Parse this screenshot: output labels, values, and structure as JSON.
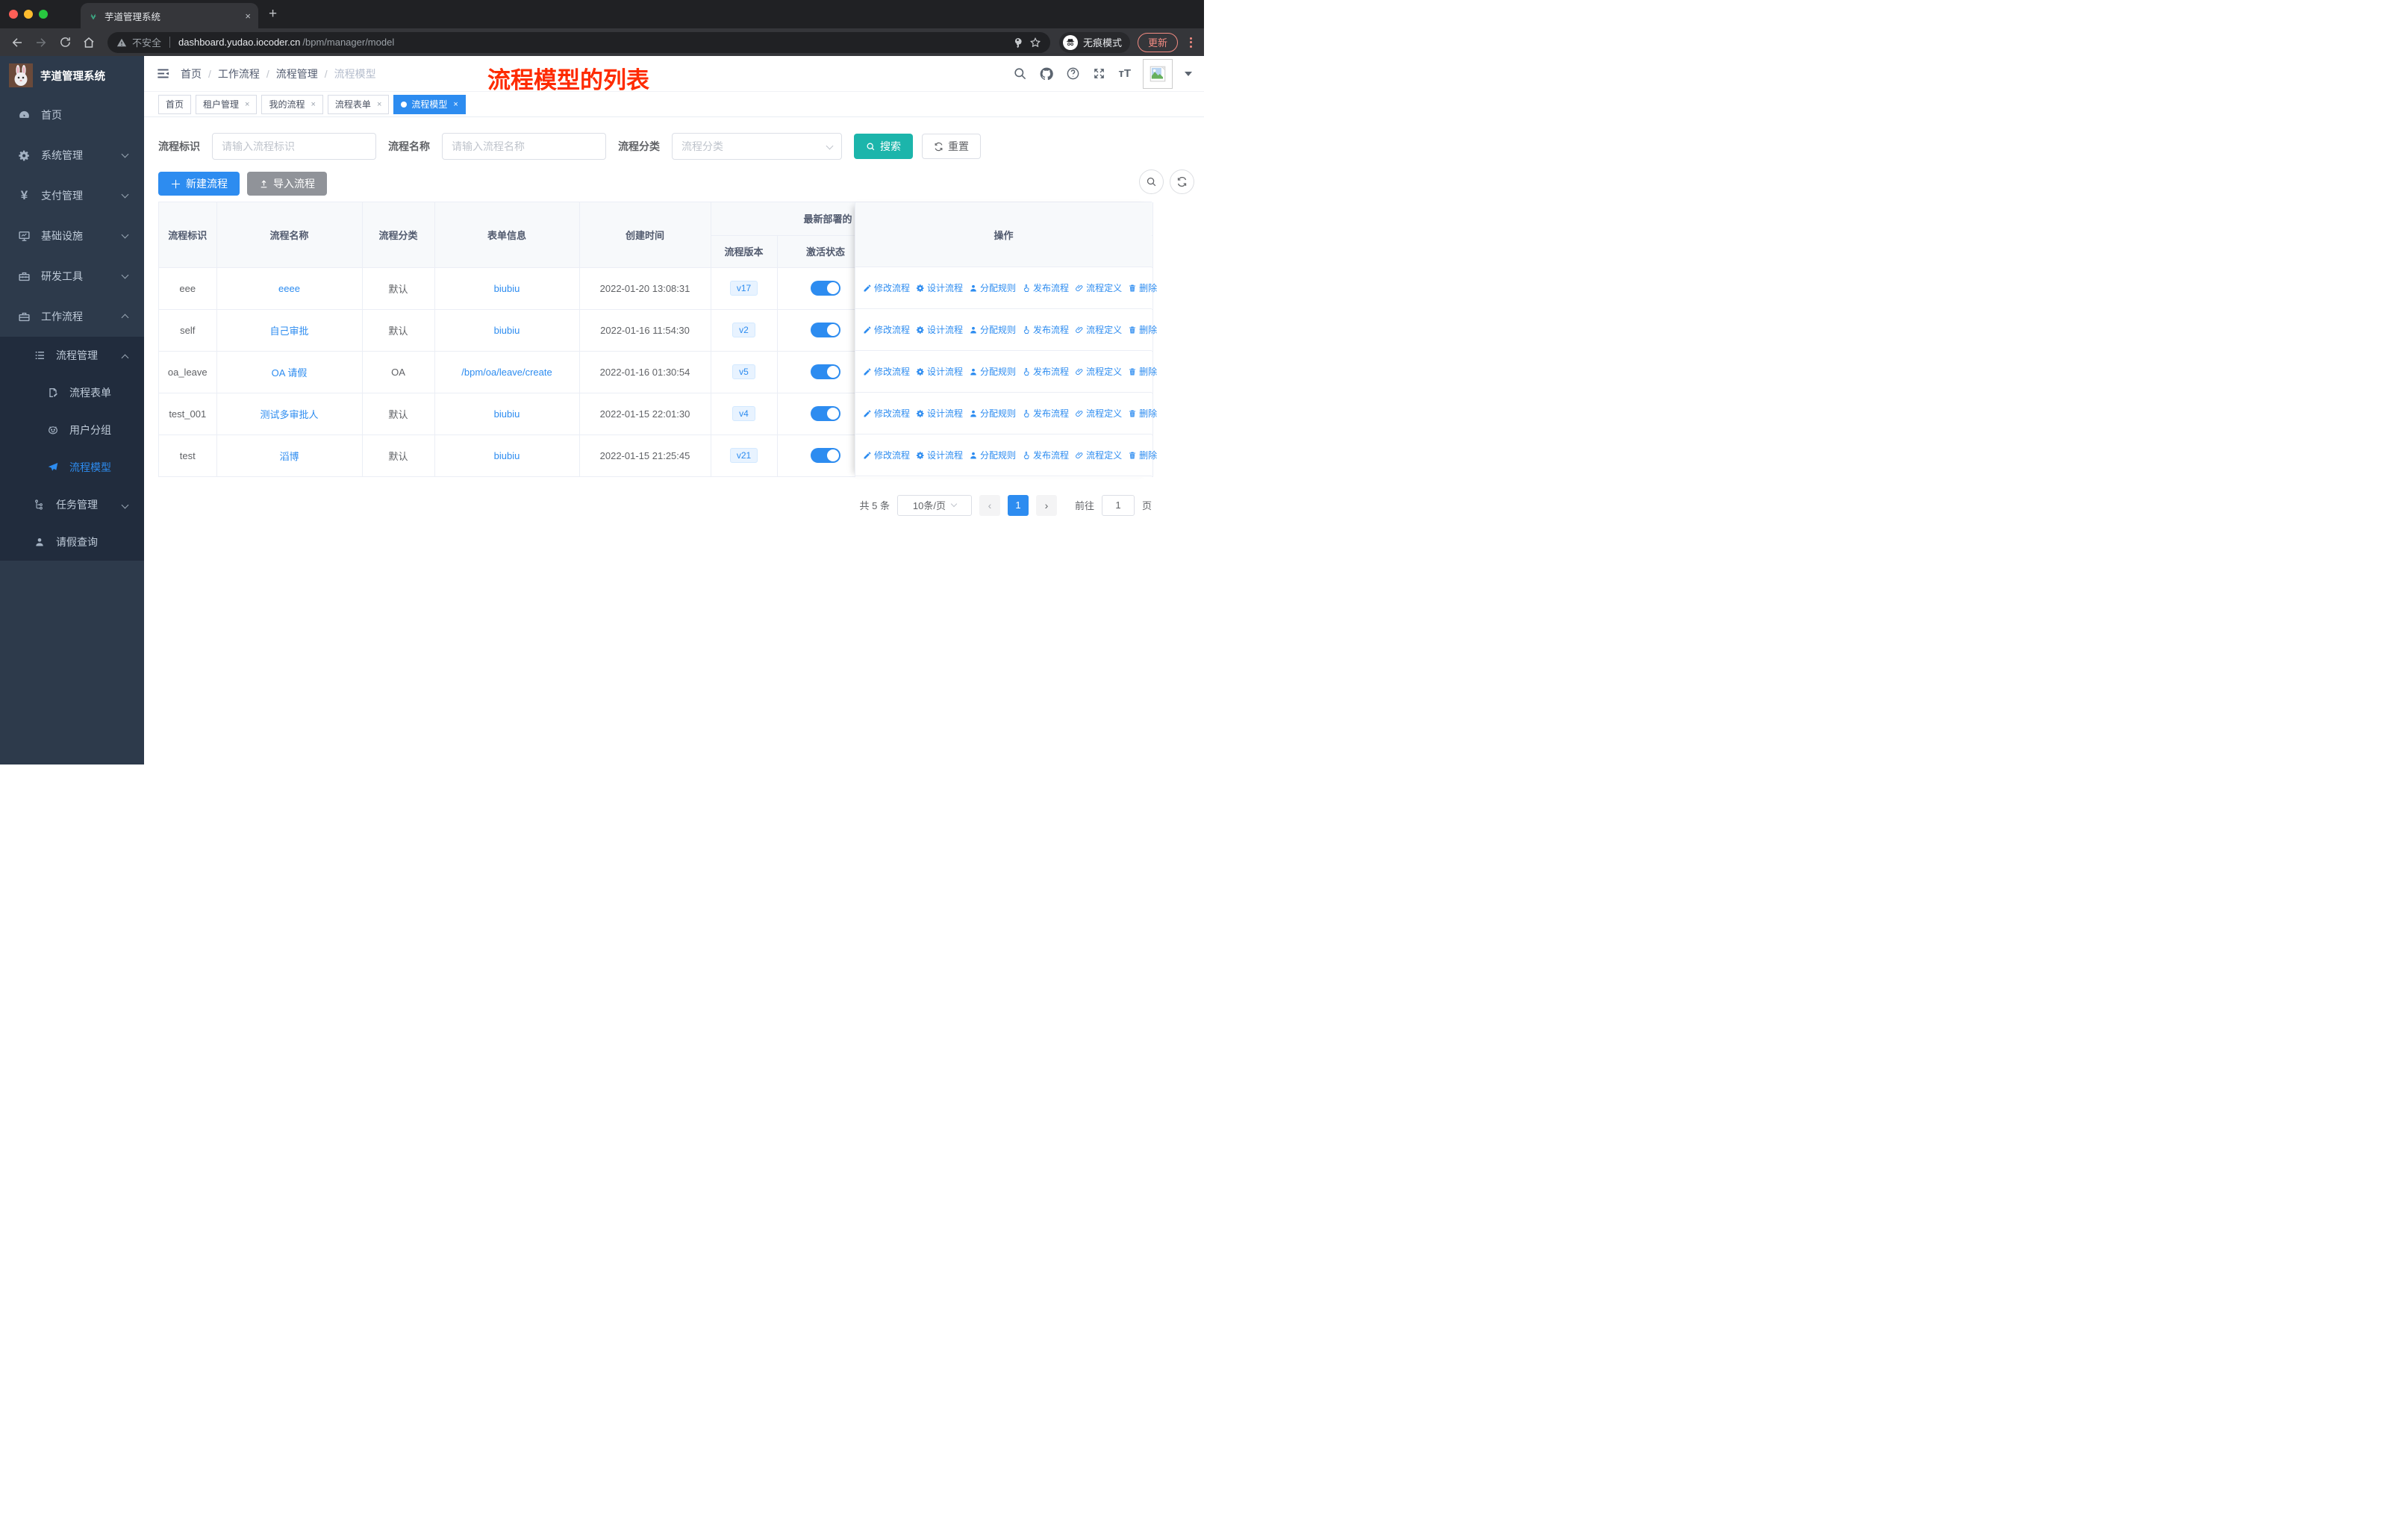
{
  "colors": {
    "primary": "#2d8cf0",
    "search_button": "#1cb5ab",
    "annotation_red": "#fe2b00",
    "sidebar_bg": "#2d3a4b"
  },
  "browser": {
    "tab_title": "芋道管理系统",
    "close_glyph": "×",
    "new_tab_glyph": "+",
    "url_security": "不安全",
    "url_domain": "dashboard.yudao.iocoder.cn",
    "url_path": "/bpm/manager/model",
    "incognito_label": "无痕模式",
    "update_label": "更新"
  },
  "sidebar": {
    "app_title": "芋道管理系统",
    "items": [
      {
        "label": "首页"
      },
      {
        "label": "系统管理"
      },
      {
        "label": "支付管理"
      },
      {
        "label": "基础设施"
      },
      {
        "label": "研发工具"
      },
      {
        "label": "工作流程"
      }
    ],
    "submenu": [
      {
        "label": "流程管理"
      },
      {
        "label": "流程表单"
      },
      {
        "label": "用户分组"
      },
      {
        "label": "流程模型"
      },
      {
        "label": "任务管理"
      },
      {
        "label": "请假查询"
      }
    ]
  },
  "header": {
    "breadcrumb": {
      "0": "首页",
      "1": "工作流程",
      "2": "流程管理",
      "3": "流程模型"
    },
    "separator": "/",
    "annotation": "流程模型的列表"
  },
  "tags": {
    "0": {
      "label": "首页"
    },
    "1": {
      "label": "租户管理",
      "close": "×"
    },
    "2": {
      "label": "我的流程",
      "close": "×"
    },
    "3": {
      "label": "流程表单",
      "close": "×"
    },
    "4": {
      "label": "流程模型",
      "close": "×"
    }
  },
  "filters": {
    "key_label": "流程标识",
    "key_placeholder": "请输入流程标识",
    "name_label": "流程名称",
    "name_placeholder": "请输入流程名称",
    "category_label": "流程分类",
    "category_placeholder": "流程分类",
    "search_label": "搜索",
    "reset_label": "重置"
  },
  "toolbar": {
    "create_label": "新建流程",
    "import_label": "导入流程"
  },
  "table": {
    "headers": {
      "id": "流程标识",
      "name": "流程名称",
      "category": "流程分类",
      "form": "表单信息",
      "created": "创建时间",
      "deploy_group": "最新部署的",
      "version": "流程版本",
      "status": "激活状态",
      "ops": "操作"
    },
    "actions": [
      "修改流程",
      "设计流程",
      "分配规则",
      "发布流程",
      "流程定义",
      "删除"
    ],
    "rows": [
      {
        "id": "eee",
        "name": "eeee",
        "category": "默认",
        "form": "biubiu",
        "created": "2022-01-20 13:08:31",
        "version": "v17",
        "active": true
      },
      {
        "id": "self",
        "name": "自己审批",
        "category": "默认",
        "form": "biubiu",
        "created": "2022-01-16 11:54:30",
        "version": "v2",
        "active": true
      },
      {
        "id": "oa_leave",
        "name": "OA 请假",
        "category": "OA",
        "form": "/bpm/oa/leave/create",
        "created": "2022-01-16 01:30:54",
        "version": "v5",
        "active": true
      },
      {
        "id": "test_001",
        "name": "测试多审批人",
        "category": "默认",
        "form": "biubiu",
        "created": "2022-01-15 22:01:30",
        "version": "v4",
        "active": true
      },
      {
        "id": "test",
        "name": "滔博",
        "category": "默认",
        "form": "biubiu",
        "created": "2022-01-15 21:25:45",
        "version": "v21",
        "active": true
      }
    ]
  },
  "pagination": {
    "total": "共 5 条",
    "page_size": "10条/页",
    "prev": "‹",
    "current": "1",
    "next": "›",
    "goto_label": "前往",
    "goto_value": "1",
    "page_unit": "页"
  }
}
